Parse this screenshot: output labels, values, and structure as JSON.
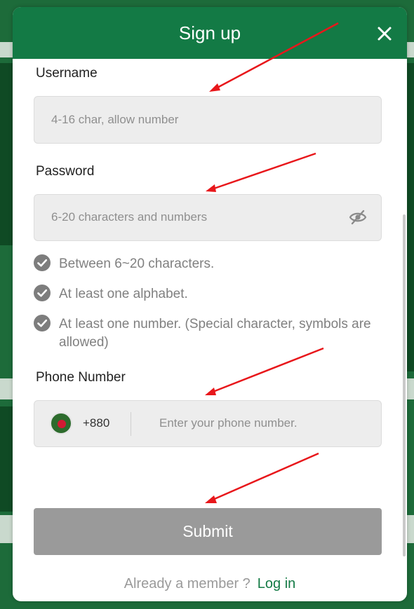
{
  "modal": {
    "title": "Sign up"
  },
  "username": {
    "label": "Username",
    "placeholder": "4-16 char, allow number"
  },
  "password": {
    "label": "Password",
    "placeholder": "6-20 characters and numbers",
    "rules": [
      "Between 6~20 characters.",
      "At least one alphabet.",
      "At least one number. (Special character, symbols are allowed)"
    ]
  },
  "phone": {
    "label": "Phone Number",
    "country_code": "+880",
    "placeholder": "Enter your phone number."
  },
  "submit": {
    "label": "Submit"
  },
  "footer": {
    "text": "Already a member ?",
    "login_label": "Log in"
  },
  "colors": {
    "header": "#137a45",
    "annotation_arrow": "#e8171b",
    "submit_disabled": "#9a9a9a",
    "link": "#137a45"
  },
  "icons": {
    "close": "close-icon",
    "password_visibility": "eye-slash-icon",
    "rule_check": "check-circle-icon",
    "country_flag": "bangladesh-flag-icon"
  }
}
